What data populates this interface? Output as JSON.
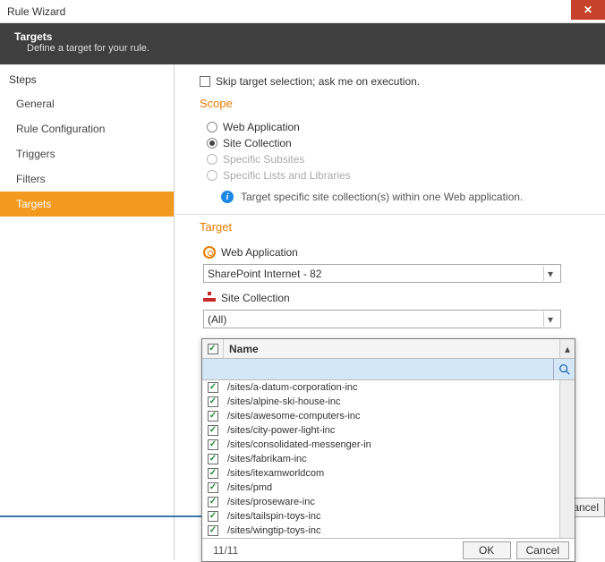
{
  "window": {
    "title": "Rule Wizard",
    "close": "✕"
  },
  "header": {
    "title": "Targets",
    "subtitle": "Define a target for your rule."
  },
  "sidebar": {
    "heading": "Steps",
    "items": [
      {
        "label": "General",
        "active": false
      },
      {
        "label": "Rule Configuration",
        "active": false
      },
      {
        "label": "Triggers",
        "active": false
      },
      {
        "label": "Filters",
        "active": false
      },
      {
        "label": "Targets",
        "active": true
      }
    ]
  },
  "main": {
    "skip_label": "Skip target selection; ask me on execution.",
    "scope": {
      "heading": "Scope",
      "options": [
        {
          "label": "Web Application",
          "selected": false,
          "enabled": true
        },
        {
          "label": "Site Collection",
          "selected": true,
          "enabled": true
        },
        {
          "label": "Specific Subsites",
          "selected": false,
          "enabled": false
        },
        {
          "label": "Specific Lists and Libraries",
          "selected": false,
          "enabled": false
        }
      ],
      "info": "Target specific site collection(s) within one Web application."
    },
    "target": {
      "heading": "Target",
      "webapp_label": "Web Application",
      "webapp_value": "SharePoint Internet - 82",
      "sitecol_label": "Site Collection",
      "sitecol_value": "(All)"
    }
  },
  "popup": {
    "name_header": "Name",
    "search_placeholder": "",
    "items": [
      "/sites/a-datum-corporation-inc",
      "/sites/alpine-ski-house-inc",
      "/sites/awesome-computers-inc",
      "/sites/city-power-light-inc",
      "/sites/consolidated-messenger-in",
      "/sites/fabrikam-inc",
      "/sites/itexamworldcom",
      "/sites/pmd",
      "/sites/proseware-inc",
      "/sites/tailspin-toys-inc",
      "/sites/wingtip-toys-inc"
    ],
    "count": "11/11",
    "ok": "OK",
    "cancel": "Cancel"
  },
  "dialog": {
    "cancel_fragment": "ancel"
  }
}
